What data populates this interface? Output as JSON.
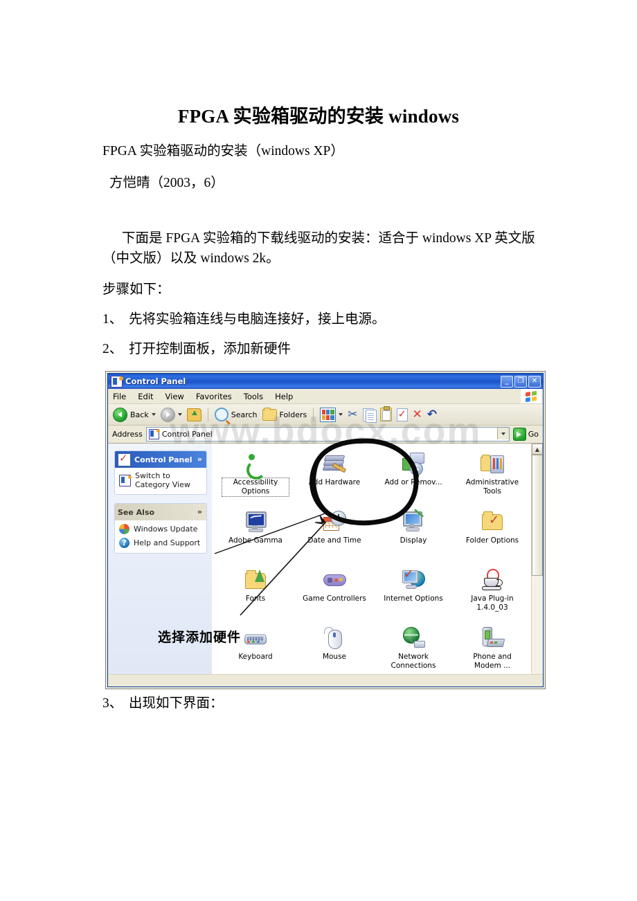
{
  "document": {
    "title": "FPGA 实验箱驱动的安装 windows",
    "subtitle": "FPGA 实验箱驱动的安装（windows XP）",
    "author": "方恺晴（2003，6）",
    "paragraph": "下面是 FPGA 实验箱的下载线驱动的安装：适合于 windows XP 英文版（中文版）以及 windows 2k。",
    "steps_intro": "步骤如下：",
    "step1_num": "1、",
    "step1_text": "先将实验箱连线与电脑连接好，接上电源。",
    "step2_num": "2、",
    "step2_text": "打开控制面板，添加新硬件",
    "step3_num": "3、",
    "step3_text": "出现如下界面："
  },
  "watermark": "www.bdocx.com",
  "annotation": {
    "label": "选择添加硬件"
  },
  "window": {
    "title": "Control Panel",
    "buttons": {
      "minimize": "_",
      "maximize": "❐",
      "close": "✕"
    },
    "menus": [
      "File",
      "Edit",
      "View",
      "Favorites",
      "Tools",
      "Help"
    ],
    "toolbar": {
      "back": "Back",
      "search": "Search",
      "folders": "Folders"
    },
    "address": {
      "label": "Address",
      "value": "Control Panel",
      "go": "Go"
    },
    "sidebar": {
      "panels": [
        {
          "title": "Control Panel",
          "collapse": "»",
          "links": [
            {
              "label": "Switch to Category View",
              "icon": "control-panel-icon"
            }
          ]
        },
        {
          "title": "See Also",
          "collapse": "»",
          "links": [
            {
              "label": "Windows Update",
              "icon": "windows-update-icon"
            },
            {
              "label": "Help and Support",
              "icon": "help-icon"
            }
          ]
        }
      ]
    },
    "items": [
      {
        "name": "Accessibility Options",
        "icon": "accessibility-icon",
        "selected": true
      },
      {
        "name": "Add Hardware",
        "icon": "add-hardware-icon",
        "selected": false
      },
      {
        "name": "Add or Remov...",
        "icon": "add-remove-programs-icon",
        "selected": false
      },
      {
        "name": "Administrative Tools",
        "icon": "administrative-tools-icon",
        "selected": false
      },
      {
        "name": "Adobe Gamma",
        "icon": "adobe-gamma-icon",
        "selected": false
      },
      {
        "name": "Date and Time",
        "icon": "date-time-icon",
        "selected": false
      },
      {
        "name": "Display",
        "icon": "display-icon",
        "selected": false
      },
      {
        "name": "Folder Options",
        "icon": "folder-options-icon",
        "selected": false
      },
      {
        "name": "Fonts",
        "icon": "fonts-icon",
        "selected": false
      },
      {
        "name": "Game Controllers",
        "icon": "game-controllers-icon",
        "selected": false
      },
      {
        "name": "Internet Options",
        "icon": "internet-options-icon",
        "selected": false
      },
      {
        "name": "Java Plug-in 1.4.0_03",
        "icon": "java-plugin-icon",
        "selected": false
      },
      {
        "name": "Keyboard",
        "icon": "keyboard-icon",
        "selected": false
      },
      {
        "name": "Mouse",
        "icon": "mouse-icon",
        "selected": false
      },
      {
        "name": "Network Connections",
        "icon": "network-connections-icon",
        "selected": false
      },
      {
        "name": "Phone and Modem ...",
        "icon": "phone-modem-icon",
        "selected": false
      }
    ],
    "scrollbar": {
      "up": "▲",
      "down": "▼"
    }
  },
  "colors": {
    "titlebar": "#1d54c8",
    "chrome": "#ece9d8",
    "sidebar_header": "#2a5bbd",
    "accent_red": "#cf3b2e",
    "accent_green": "#1d9c29"
  }
}
